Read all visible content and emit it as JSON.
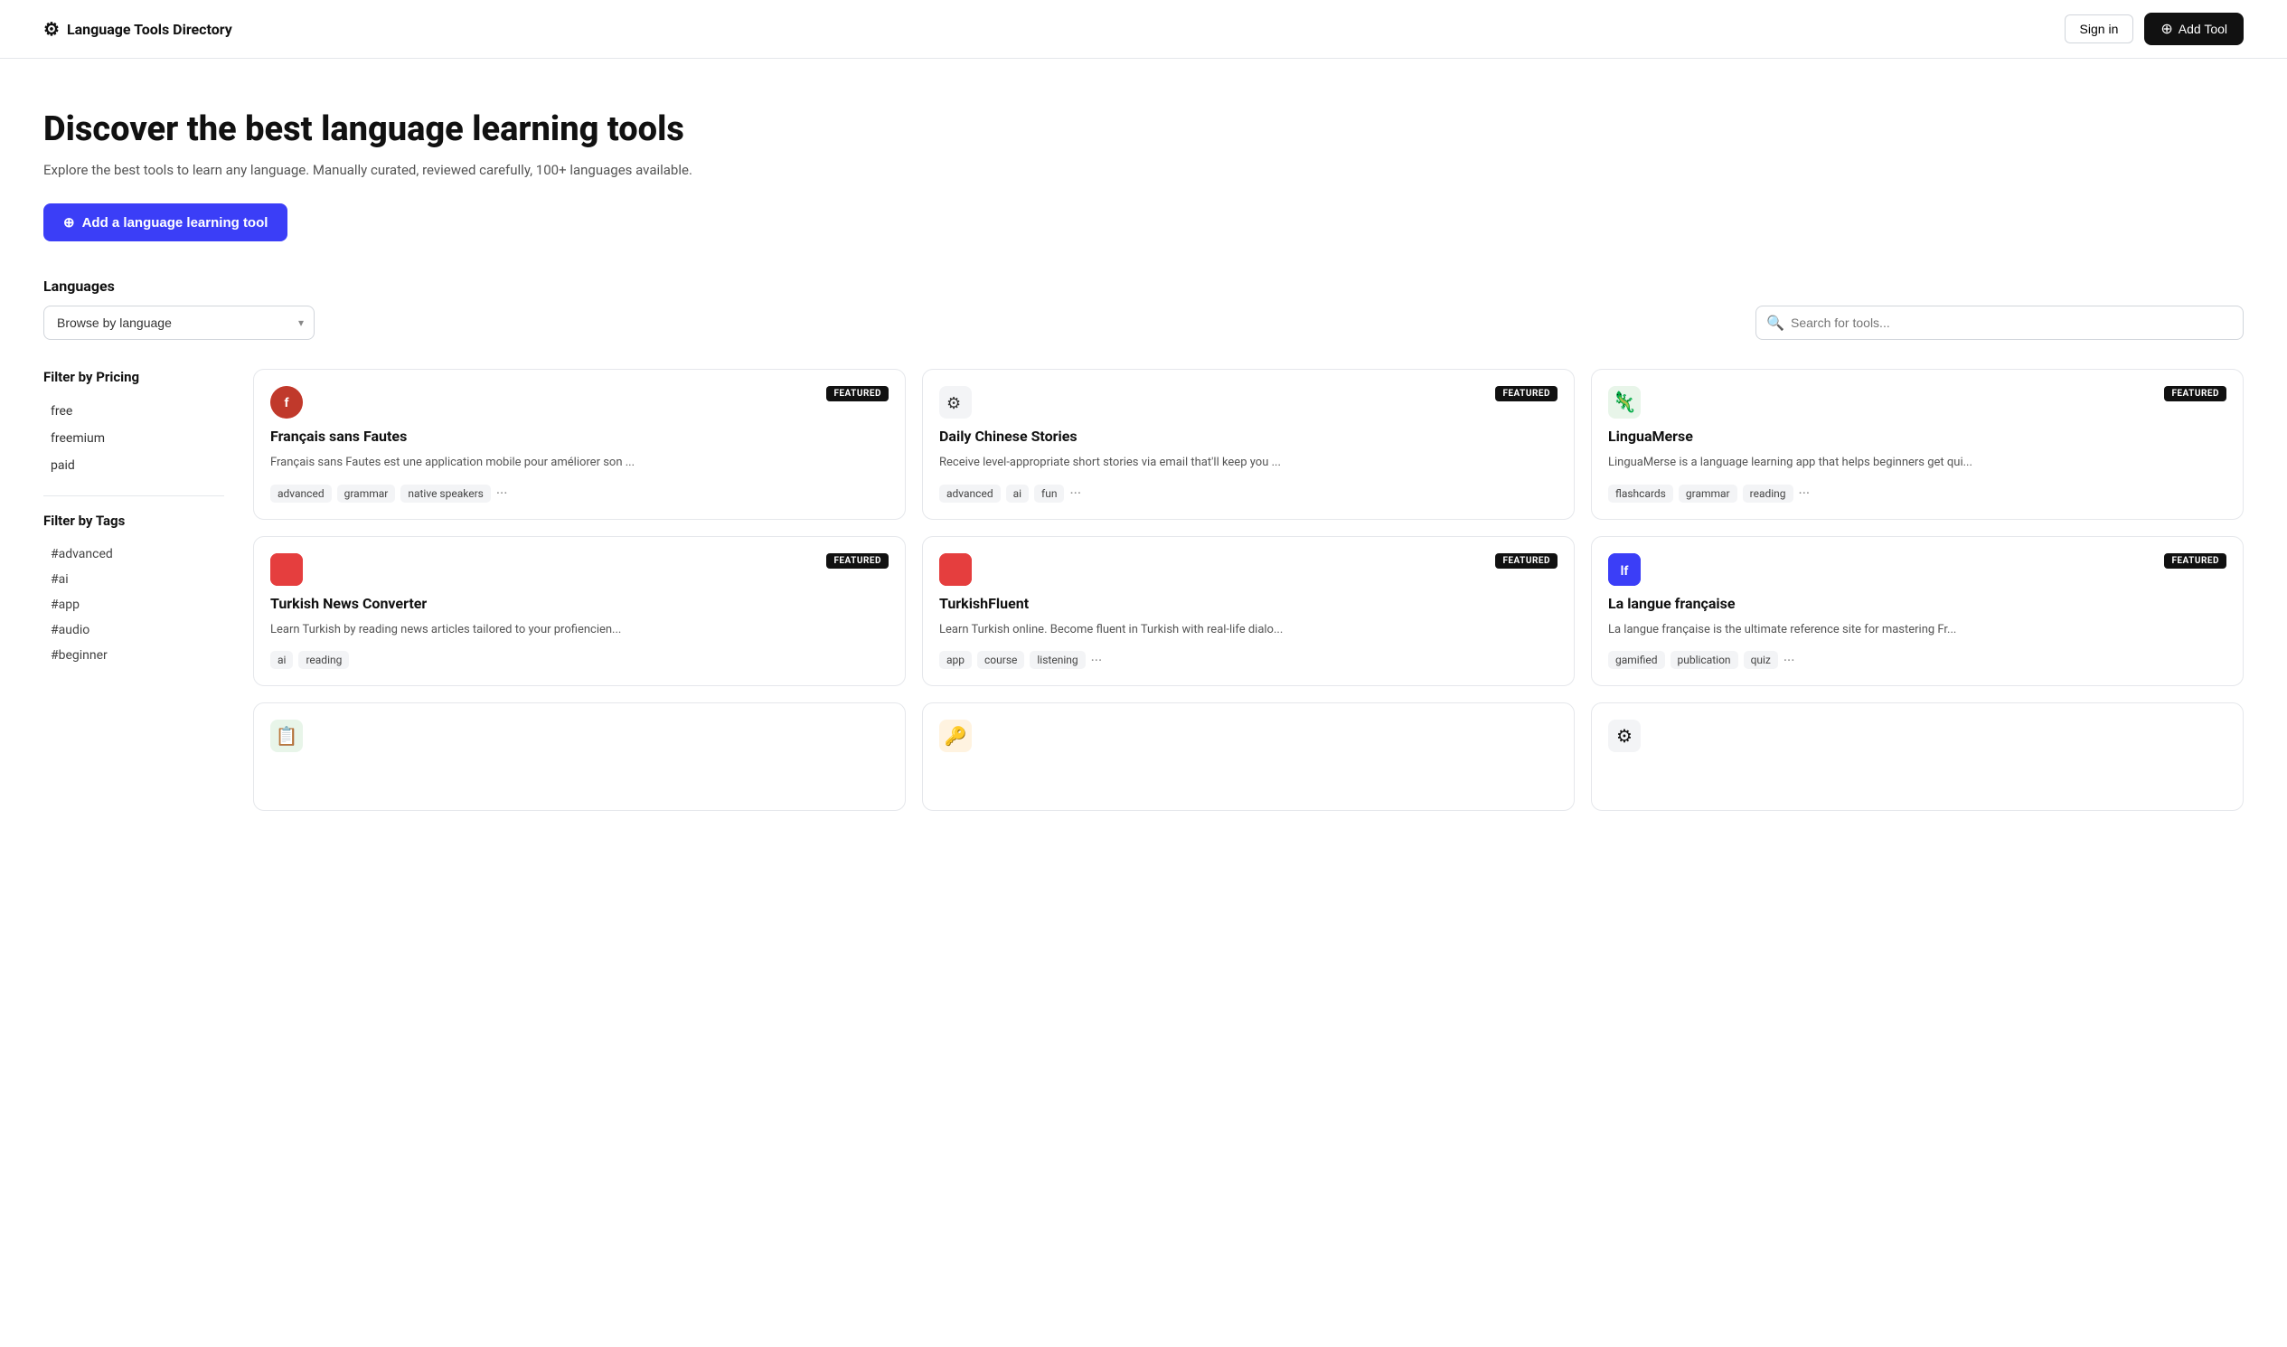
{
  "nav": {
    "logo_icon": "🀄",
    "logo_text": "Language Tools Directory",
    "signin_label": "Sign in",
    "addtool_label": "Add Tool"
  },
  "hero": {
    "title": "Discover the best language learning tools",
    "subtitle": "Explore the best tools to learn any language. Manually curated, reviewed carefully, 100+ languages available.",
    "cta_label": "Add a language learning tool"
  },
  "languages": {
    "section_label": "Languages",
    "dropdown_placeholder": "Browse by language",
    "search_placeholder": "Search for tools..."
  },
  "sidebar": {
    "pricing_title": "Filter by Pricing",
    "pricing_items": [
      "free",
      "freemium",
      "paid"
    ],
    "tags_title": "Filter by Tags",
    "tag_items": [
      "#advanced",
      "#ai",
      "#app",
      "#audio",
      "#beginner"
    ]
  },
  "cards": [
    {
      "id": 1,
      "logo_emoji": "🔵",
      "logo_type": "circle-avatar",
      "featured": true,
      "title": "Français sans Fautes",
      "desc": "Français sans Fautes est une application mobile pour améliorer son ...",
      "tags": [
        "advanced",
        "grammar",
        "native speakers"
      ],
      "extra_tags": true
    },
    {
      "id": 2,
      "logo_emoji": "⚙",
      "logo_type": "translate-icon",
      "featured": true,
      "title": "Daily Chinese Stories",
      "desc": "Receive level-appropriate short stories via email that'll keep you ...",
      "tags": [
        "advanced",
        "ai",
        "fun"
      ],
      "extra_tags": true
    },
    {
      "id": 3,
      "logo_emoji": "🦎",
      "logo_type": "gecko",
      "featured": true,
      "title": "LinguaMerse",
      "desc": "LinguaMerse is a language learning app that helps beginners get qui...",
      "tags": [
        "flashcards",
        "grammar",
        "reading"
      ],
      "extra_tags": true
    },
    {
      "id": 4,
      "logo_emoji": "🟥",
      "logo_type": "red-square",
      "featured": true,
      "title": "Turkish News Converter",
      "desc": "Learn Turkish by reading news articles tailored to your profiencien...",
      "tags": [
        "ai",
        "reading"
      ],
      "extra_tags": false
    },
    {
      "id": 5,
      "logo_emoji": "🟥",
      "logo_type": "red-square",
      "featured": true,
      "title": "TurkishFluent",
      "desc": "Learn Turkish online. Become fluent in Turkish with real-life dialo...",
      "tags": [
        "app",
        "course",
        "listening"
      ],
      "extra_tags": true
    },
    {
      "id": 6,
      "logo_emoji": "🔷",
      "logo_type": "blue-square",
      "featured": true,
      "title": "La langue française",
      "desc": "La langue française is the ultimate reference site for mastering Fr...",
      "tags": [
        "gamified",
        "publication",
        "quiz"
      ],
      "extra_tags": true
    }
  ],
  "bottom_cards": [
    {
      "id": 7,
      "logo_emoji": "📋",
      "logo_type": "list"
    },
    {
      "id": 8,
      "logo_emoji": "🔑",
      "logo_type": "key"
    },
    {
      "id": 9,
      "logo_emoji": "🔤",
      "logo_type": "translate"
    }
  ],
  "colors": {
    "hero_btn": "#3b3ef7",
    "addtool_btn": "#111111",
    "featured_bg": "#111111"
  }
}
